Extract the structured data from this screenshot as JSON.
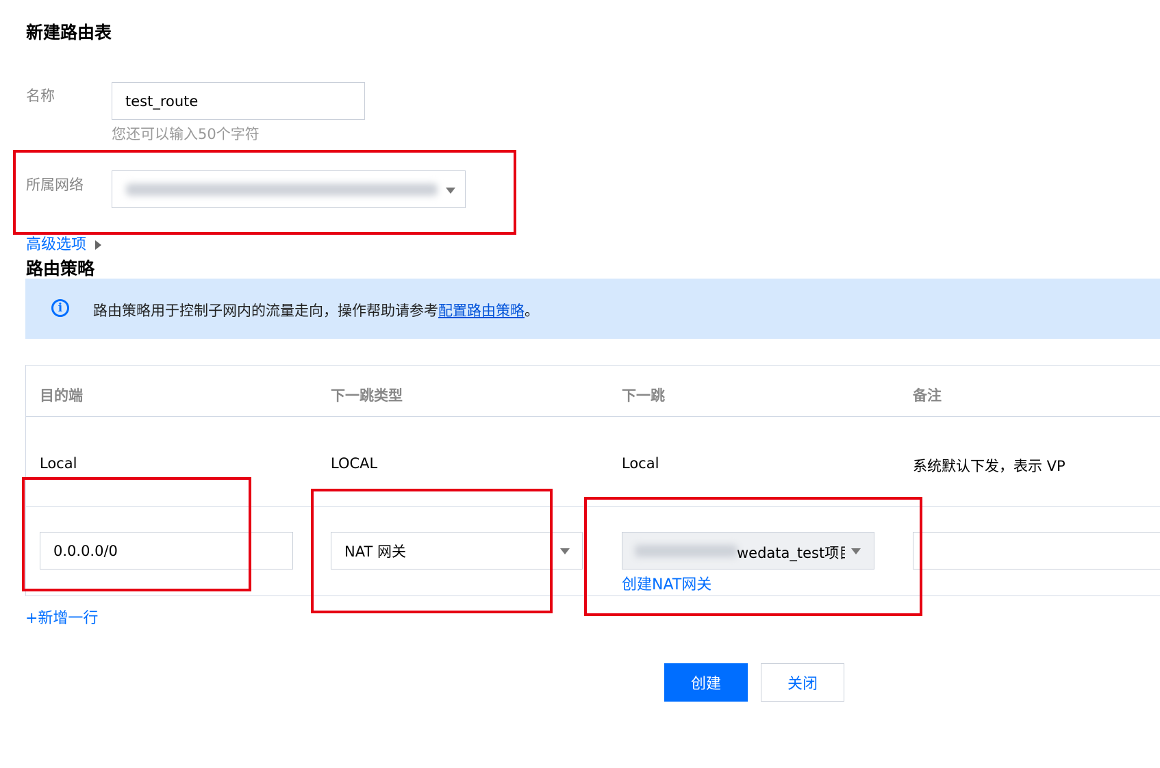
{
  "page": {
    "title": "新建路由表"
  },
  "form": {
    "name_label": "名称",
    "name_value": "test_route",
    "name_hint": "您还可以输入50个字符",
    "network_label": "所属网络",
    "advanced_label": "高级选项"
  },
  "policy": {
    "section_title": "路由策略",
    "notice_text": "路由策略用于控制子网内的流量走向，操作帮助请参考",
    "notice_link": "配置路由策略",
    "notice_suffix": "。"
  },
  "table": {
    "columns": [
      "目的端",
      "下一跳类型",
      "下一跳",
      "备注"
    ],
    "default_row": {
      "destination": "Local",
      "next_hop_type": "LOCAL",
      "next_hop": "Local",
      "note": "系统默认下发，表示 VP"
    },
    "edit_row": {
      "destination_value": "0.0.0.0/0",
      "next_hop_type_value": "NAT 网关",
      "next_hop_value": "wedata_test项目",
      "create_nat_link": "创建NAT网关",
      "note_value": ""
    },
    "add_row_label": "+新增一行"
  },
  "actions": {
    "create_label": "创建",
    "close_label": "关闭"
  },
  "colors": {
    "accent": "#006eff",
    "highlight_box": "#e60012",
    "notice_bg": "#d6e8fd"
  }
}
